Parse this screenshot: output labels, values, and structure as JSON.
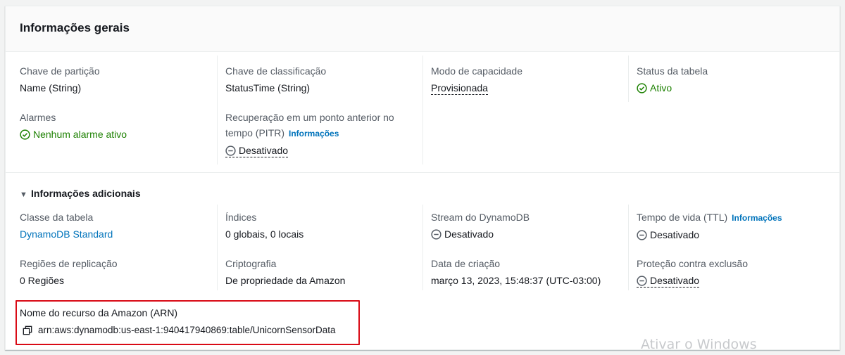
{
  "panel": {
    "title": "Informações gerais"
  },
  "general": {
    "partition_key": {
      "label": "Chave de partição",
      "value": "Name (String)"
    },
    "sort_key": {
      "label": "Chave de classificação",
      "value": "StatusTime (String)"
    },
    "capacity_mode": {
      "label": "Modo de capacidade",
      "value": "Provisionada"
    },
    "table_status": {
      "label": "Status da tabela",
      "value": "Ativo",
      "icon": "check-circle-icon",
      "color": "#1d8102"
    },
    "alarms": {
      "label": "Alarmes",
      "value": "Nenhum alarme ativo",
      "icon": "check-circle-icon",
      "color": "#1d8102"
    },
    "pitr": {
      "label_line1": "Recuperação em um ponto anterior no",
      "label_line2": "tempo (PITR)",
      "info": "Informações",
      "value": "Desativado",
      "icon": "minus-circle-icon"
    }
  },
  "additional": {
    "toggle_label": "Informações adicionais",
    "table_class": {
      "label": "Classe da tabela",
      "value": "DynamoDB Standard",
      "color": "#0073bb"
    },
    "indexes": {
      "label": "Índices",
      "value": "0 globais, 0 locais"
    },
    "stream": {
      "label": "Stream do DynamoDB",
      "value": "Desativado",
      "icon": "minus-circle-icon"
    },
    "ttl": {
      "label": "Tempo de vida (TTL)",
      "info": "Informações",
      "value": "Desativado",
      "icon": "minus-circle-icon"
    },
    "replica_regions": {
      "label": "Regiões de replicação",
      "value": "0 Regiões"
    },
    "encryption": {
      "label": "Criptografia",
      "value": "De propriedade da Amazon"
    },
    "creation_date": {
      "label": "Data de criação",
      "value": "março 13, 2023, 15:48:37 (UTC-03:00)"
    },
    "deletion_protection": {
      "label": "Proteção contra exclusão",
      "value": "Desativado",
      "icon": "minus-circle-icon"
    },
    "arn": {
      "label": "Nome do recurso da Amazon (ARN)",
      "value": "arn:aws:dynamodb:us-east-1:940417940869:table/UnicornSensorData",
      "icon": "copy-icon"
    }
  },
  "watermark": "Ativar o Windows",
  "colors": {
    "highlight_box": "#d90b16",
    "link": "#0073bb",
    "success": "#1d8102"
  }
}
